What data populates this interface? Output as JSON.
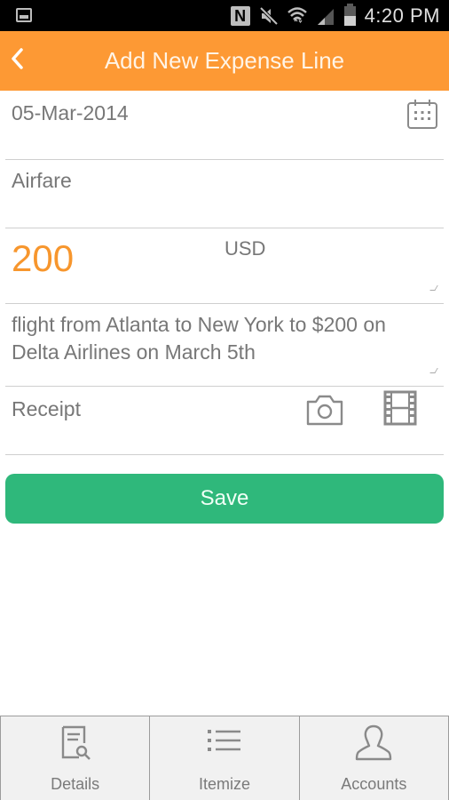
{
  "status_bar": {
    "left_icon": "image-icon",
    "icons": [
      "nfc-icon",
      "mute-icon",
      "wifi-icon",
      "signal-icon",
      "battery-icon"
    ],
    "nfc_letter": "N",
    "time": "4:20 PM",
    "battery_level_percent": 50
  },
  "app_bar": {
    "title": "Add New Expense Line",
    "back_icon": "chevron-left-icon",
    "color": "#fd9934"
  },
  "form": {
    "date": {
      "value": "05-Mar-2014",
      "icon": "calendar-icon"
    },
    "category": {
      "value": "Airfare"
    },
    "amount": {
      "value": "200",
      "currency": "USD",
      "color": "#f7962d"
    },
    "description": {
      "value": "flight from Atlanta to New York to $200 on Delta Airlines on March 5th"
    },
    "receipt": {
      "label": "Receipt",
      "camera_icon": "camera-icon",
      "gallery_icon": "film-icon"
    }
  },
  "save_button": {
    "label": "Save",
    "color": "#2fb87b"
  },
  "bottom_nav": {
    "items": [
      {
        "label": "Details",
        "icon": "document-search-icon"
      },
      {
        "label": "Itemize",
        "icon": "list-icon"
      },
      {
        "label": "Accounts",
        "icon": "user-icon"
      }
    ]
  }
}
